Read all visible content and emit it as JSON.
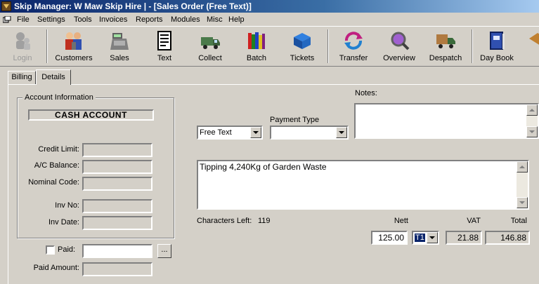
{
  "window": {
    "title": "Skip Manager: W Maw Skip Hire   | - [Sales Order (Free Text)]"
  },
  "menu": [
    "File",
    "Settings",
    "Tools",
    "Invoices",
    "Reports",
    "Modules",
    "Misc",
    "Help"
  ],
  "toolbar": {
    "login": "Login",
    "customers": "Customers",
    "sales": "Sales",
    "text": "Text",
    "collect": "Collect",
    "batch": "Batch",
    "tickets": "Tickets",
    "transfer": "Transfer",
    "overview": "Overview",
    "despatch": "Despatch",
    "daybook": "Day Book"
  },
  "tabs": {
    "billing": "Billing",
    "details": "Details"
  },
  "account": {
    "group_label": "Account Information",
    "name": "CASH ACCOUNT",
    "credit_limit_label": "Credit Limit:",
    "balance_label": "A/C Balance:",
    "nominal_label": "Nominal Code:",
    "inv_no_label": "Inv No:",
    "inv_date_label": "Inv Date:"
  },
  "paid": {
    "label": "Paid:",
    "amount_label": "Paid Amount:",
    "browse": "...",
    "checked": false
  },
  "order": {
    "notes_label": "Notes:",
    "payment_type_label": "Payment Type",
    "text_type": "Free Text",
    "payment_type": "",
    "description": "Tipping 4,240Kg of Garden Waste",
    "chars_left_label": "Characters Left:",
    "chars_left": "119"
  },
  "totals": {
    "nett_label": "Nett",
    "vat_label": "VAT",
    "total_label": "Total",
    "nett": "125.00",
    "vat_code": "T1",
    "vat": "21.88",
    "total": "146.88"
  }
}
